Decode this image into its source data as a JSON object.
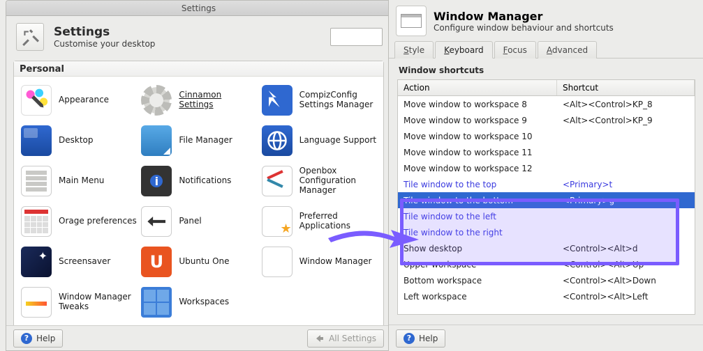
{
  "settings": {
    "titlebar": "Settings",
    "header_title": "Settings",
    "header_sub": "Customise your desktop",
    "category": "Personal",
    "items": [
      {
        "label": "Appearance",
        "name": "appearance"
      },
      {
        "label": "Cinnamon Settings",
        "name": "cinnamon-settings",
        "underline": true
      },
      {
        "label": "CompizConfig Settings Manager",
        "name": "compizconfig"
      },
      {
        "label": "Desktop",
        "name": "desktop"
      },
      {
        "label": "File Manager",
        "name": "file-manager"
      },
      {
        "label": "Language Support",
        "name": "language-support"
      },
      {
        "label": "Main Menu",
        "name": "main-menu"
      },
      {
        "label": "Notifications",
        "name": "notifications"
      },
      {
        "label": "Openbox Configuration Manager",
        "name": "openbox-config"
      },
      {
        "label": "Orage preferences",
        "name": "orage"
      },
      {
        "label": "Panel",
        "name": "panel"
      },
      {
        "label": "Preferred Applications",
        "name": "preferred-apps"
      },
      {
        "label": "Screensaver",
        "name": "screensaver"
      },
      {
        "label": "Ubuntu One",
        "name": "ubuntu-one"
      },
      {
        "label": "Window Manager",
        "name": "window-manager"
      },
      {
        "label": "Window Manager Tweaks",
        "name": "wm-tweaks"
      },
      {
        "label": "Workspaces",
        "name": "workspaces"
      }
    ],
    "help_label": "Help",
    "all_settings_label": "All Settings"
  },
  "wm": {
    "header_title": "Window Manager",
    "header_sub": "Configure window behaviour and shortcuts",
    "tabs": [
      "Style",
      "Keyboard",
      "Focus",
      "Advanced"
    ],
    "active_tab": 1,
    "section": "Window shortcuts",
    "col_a": "Action",
    "col_b": "Shortcut",
    "rows": [
      {
        "a": "Move window to workspace 8",
        "b": "<Alt><Control>KP_8"
      },
      {
        "a": "Move window to workspace 9",
        "b": "<Alt><Control>KP_9"
      },
      {
        "a": "Move window to workspace 10",
        "b": ""
      },
      {
        "a": "Move window to workspace 11",
        "b": ""
      },
      {
        "a": "Move window to workspace 12",
        "b": ""
      },
      {
        "a": "Tile window to the top",
        "b": "<Primary>t",
        "hi": true
      },
      {
        "a": "Tile window to the bottom",
        "b": "<Primary>g",
        "hi": true,
        "sel": true
      },
      {
        "a": "Tile window to the left",
        "b": "",
        "hi": true
      },
      {
        "a": "Tile window to the right",
        "b": "",
        "hi": true
      },
      {
        "a": "Show desktop",
        "b": "<Control><Alt>d"
      },
      {
        "a": "Upper workspace",
        "b": "<Control><Alt>Up"
      },
      {
        "a": "Bottom workspace",
        "b": "<Control><Alt>Down"
      },
      {
        "a": "Left workspace",
        "b": "<Control><Alt>Left"
      }
    ],
    "help_label": "Help",
    "annotation": {
      "arrow": true,
      "highlight_rows": [
        5,
        6,
        7,
        8
      ],
      "selected_row": 6,
      "color": "#7a5cff"
    }
  }
}
